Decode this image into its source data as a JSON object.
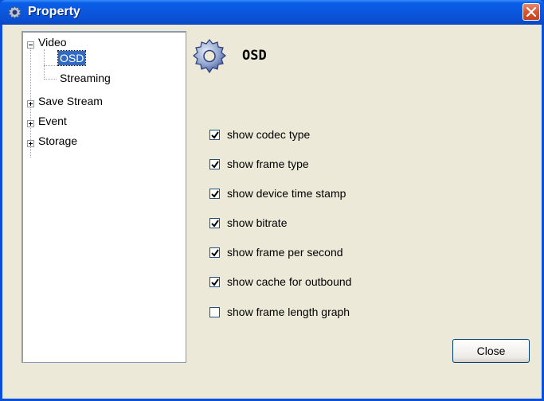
{
  "window": {
    "title": "Property"
  },
  "tree": {
    "items": [
      {
        "label": "Video"
      },
      {
        "label": "OSD"
      },
      {
        "label": "Streaming"
      },
      {
        "label": "Save Stream"
      },
      {
        "label": "Event"
      },
      {
        "label": "Storage"
      }
    ]
  },
  "panel": {
    "title": "OSD",
    "options": [
      {
        "label": "show codec type",
        "checked": true
      },
      {
        "label": "show frame type",
        "checked": true
      },
      {
        "label": "show device time stamp",
        "checked": true
      },
      {
        "label": "show bitrate",
        "checked": true
      },
      {
        "label": "show frame per second",
        "checked": true
      },
      {
        "label": "show cache for outbound",
        "checked": true
      },
      {
        "label": "show frame length graph",
        "checked": false
      }
    ]
  },
  "buttons": {
    "close_label": "Close"
  },
  "icons": {
    "title": "gear-icon",
    "header": "gear-icon",
    "close": "close-icon"
  }
}
